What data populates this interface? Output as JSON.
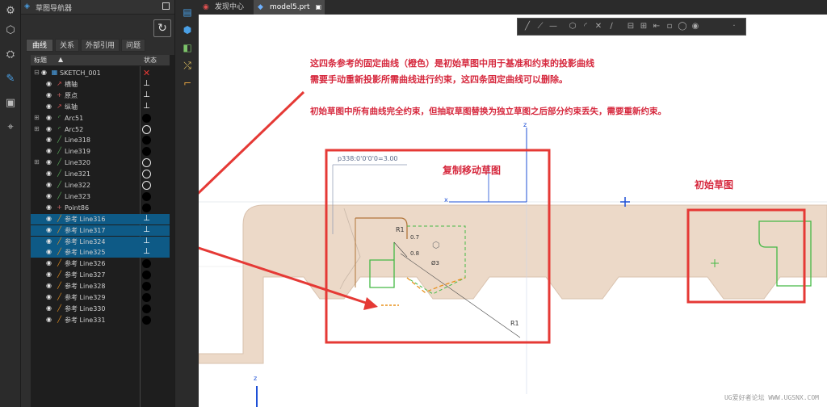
{
  "navigator": {
    "title": "草图导航器",
    "tabs": [
      "曲线",
      "关系",
      "外部引用",
      "问题"
    ],
    "header_name": "标题",
    "header_state": "状态",
    "rows": [
      {
        "label": "SKETCH_001",
        "type": "sketch",
        "state": "bad",
        "expand": "⊟",
        "indent": 0
      },
      {
        "label": "横轴",
        "type": "axis",
        "state": "fixed",
        "expand": "",
        "indent": 1
      },
      {
        "label": "原点",
        "type": "point",
        "state": "fixed",
        "expand": "",
        "indent": 1
      },
      {
        "label": "纵轴",
        "type": "axis",
        "state": "fixed",
        "expand": "",
        "indent": 1
      },
      {
        "label": "Arc51",
        "type": "arc",
        "state": "dot",
        "expand": "⊞",
        "indent": 1
      },
      {
        "label": "Arc52",
        "type": "arc",
        "state": "ring",
        "expand": "⊞",
        "indent": 1
      },
      {
        "label": "Line318",
        "type": "line",
        "state": "dot",
        "expand": "",
        "indent": 1
      },
      {
        "label": "Line319",
        "type": "line",
        "state": "dot",
        "expand": "",
        "indent": 1
      },
      {
        "label": "Line320",
        "type": "line",
        "state": "ring",
        "expand": "⊞",
        "indent": 1
      },
      {
        "label": "Line321",
        "type": "line",
        "state": "ring",
        "expand": "",
        "indent": 1
      },
      {
        "label": "Line322",
        "type": "line",
        "state": "ring",
        "expand": "",
        "indent": 1
      },
      {
        "label": "Line323",
        "type": "line",
        "state": "dot",
        "expand": "",
        "indent": 1
      },
      {
        "label": "Point86",
        "type": "point",
        "state": "dot",
        "expand": "",
        "indent": 1
      },
      {
        "label": "参考 Line316",
        "type": "ref",
        "state": "fixed",
        "expand": "",
        "indent": 1,
        "selected": true
      },
      {
        "label": "参考 Line317",
        "type": "ref",
        "state": "fixed",
        "expand": "",
        "indent": 1,
        "selected": true
      },
      {
        "label": "参考 Line324",
        "type": "ref",
        "state": "fixed",
        "expand": "",
        "indent": 1,
        "selected": true
      },
      {
        "label": "参考 Line325",
        "type": "ref",
        "state": "fixed",
        "expand": "",
        "indent": 1,
        "selected": true
      },
      {
        "label": "参考 Line326",
        "type": "ref",
        "state": "dot",
        "expand": "",
        "indent": 1
      },
      {
        "label": "参考 Line327",
        "type": "ref",
        "state": "dot",
        "expand": "",
        "indent": 1
      },
      {
        "label": "参考 Line328",
        "type": "ref",
        "state": "dot",
        "expand": "",
        "indent": 1
      },
      {
        "label": "参考 Line329",
        "type": "ref",
        "state": "dot",
        "expand": "",
        "indent": 1
      },
      {
        "label": "参考 Line330",
        "type": "ref",
        "state": "dot",
        "expand": "",
        "indent": 1
      },
      {
        "label": "参考 Line331",
        "type": "ref",
        "state": "dot",
        "expand": "",
        "indent": 1
      }
    ]
  },
  "doc_tabs": [
    {
      "label": "发现中心",
      "active": false
    },
    {
      "label": "model5.prt",
      "active": true
    }
  ],
  "canvas": {
    "annotation_1": "这四条参考的固定曲线（橙色）是初始草图中用于基准和约束的投影曲线",
    "annotation_2": "需要手动重新投影所需曲线进行约束，这四条固定曲线可以删除。",
    "annotation_3": "初始草图中所有曲线完全约束，但抽取草图替换为独立草图之后部分约束丢失，需要重新约束。",
    "label_copy": "复制移动草图",
    "label_initial": "初始草图",
    "dim_angle": "p338:0'0'0'0=3.00",
    "dim_r1": "R1",
    "dim_r1b": "R1",
    "dim_07": "0.7",
    "dim_08": "0.8",
    "dim_d3": "Ø3",
    "axis_z": "z",
    "axis_x": "x",
    "watermark": "UG爱好者论坛 WWW.UGSNX.COM"
  },
  "colors": {
    "annotation_red": "#d6283d",
    "selection_blue": "#0e5a86",
    "body_tan": "#ecd9c8",
    "sketch_green": "#44b944",
    "ref_orange": "#e8901c",
    "axis_blue": "#1d4fd6"
  }
}
